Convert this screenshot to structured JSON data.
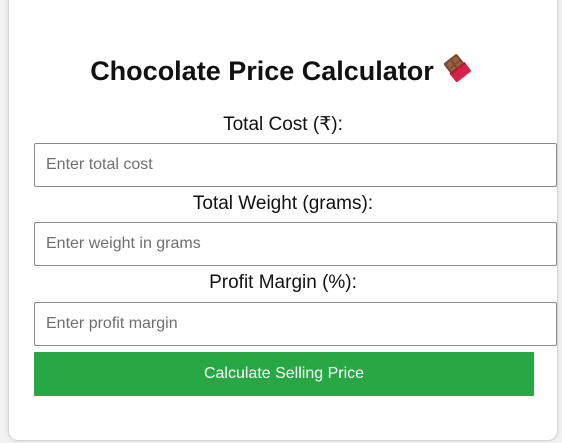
{
  "calculator": {
    "title": "Chocolate Price Calculator",
    "title_icon": "chocolate-bar-icon",
    "fields": [
      {
        "label": "Total Cost (₹):",
        "placeholder": "Enter total cost",
        "value": ""
      },
      {
        "label": "Total Weight (grams):",
        "placeholder": "Enter weight in grams",
        "value": ""
      },
      {
        "label": "Profit Margin (%):",
        "placeholder": "Enter profit margin",
        "value": ""
      }
    ],
    "button_label": "Calculate Selling Price"
  },
  "colors": {
    "button": "#28a745",
    "button_text": "#ffffff",
    "card_background": "#ffffff",
    "page_background": "#f2f2f2"
  }
}
